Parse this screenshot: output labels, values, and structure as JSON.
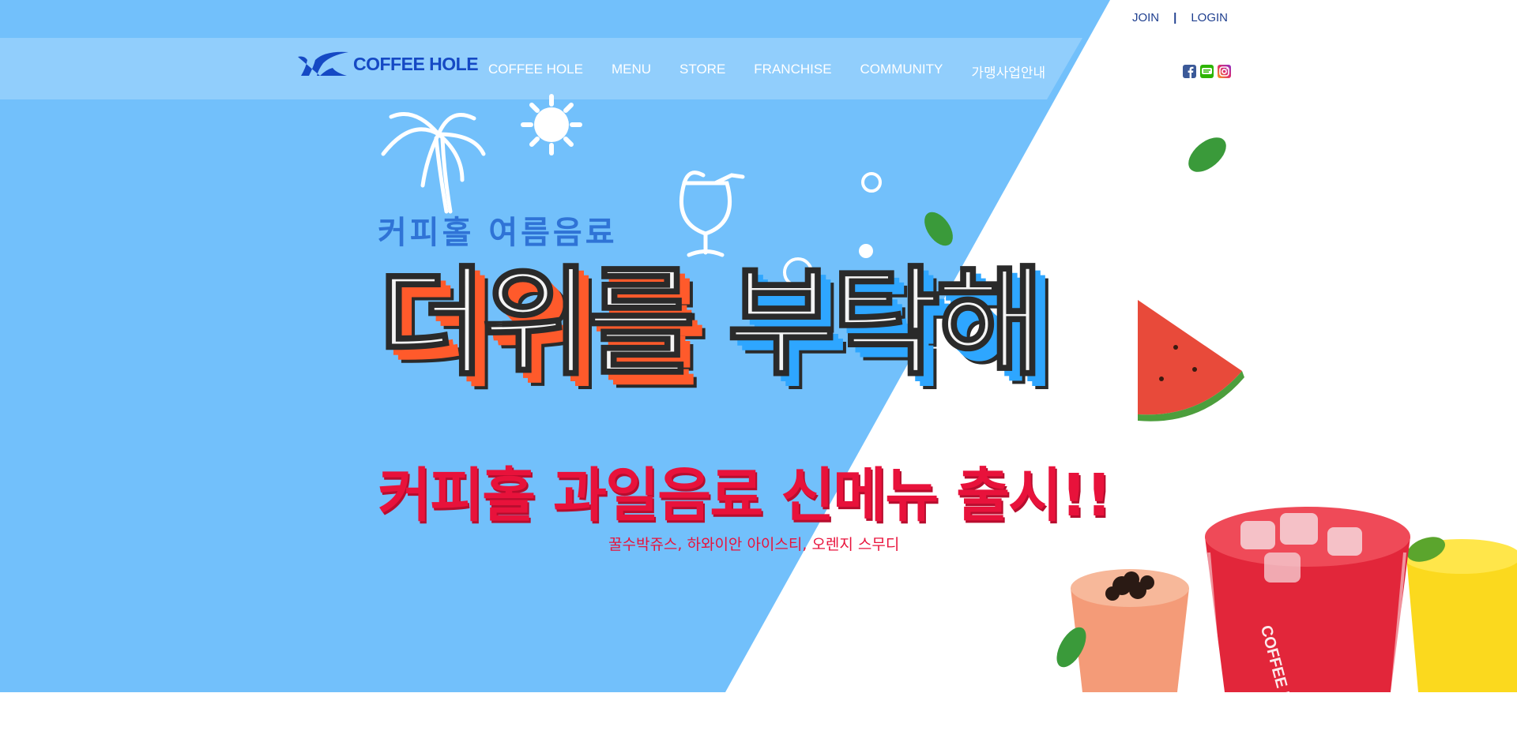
{
  "top_links": {
    "join": "JOIN",
    "separator": "|",
    "login": "LOGIN"
  },
  "logo": {
    "text": "COFFEE HOLE"
  },
  "nav": {
    "items": [
      "COFFEE HOLE",
      "MENU",
      "STORE",
      "FRANCHISE",
      "COMMUNITY",
      "가맹사업안내"
    ]
  },
  "social": {
    "icons": [
      "facebook-icon",
      "blog-icon",
      "instagram-icon"
    ]
  },
  "hero": {
    "subtitle": "커피홀 여름음료",
    "title_part1": "더위를",
    "title_part2": "부탁해",
    "headline": "커피홀 과일음료 신메뉴 출시!!",
    "description": "꿀수박쥬스, 하와이안 아이스티, 오렌지 스무디",
    "cup_label": "COFFEE HOLE"
  },
  "colors": {
    "sky_blue": "#72c0fb",
    "brand_blue": "#1549c4",
    "accent_red": "#e8123b",
    "title_orange": "#ff5a2b",
    "title_blue": "#2ea6ff"
  }
}
